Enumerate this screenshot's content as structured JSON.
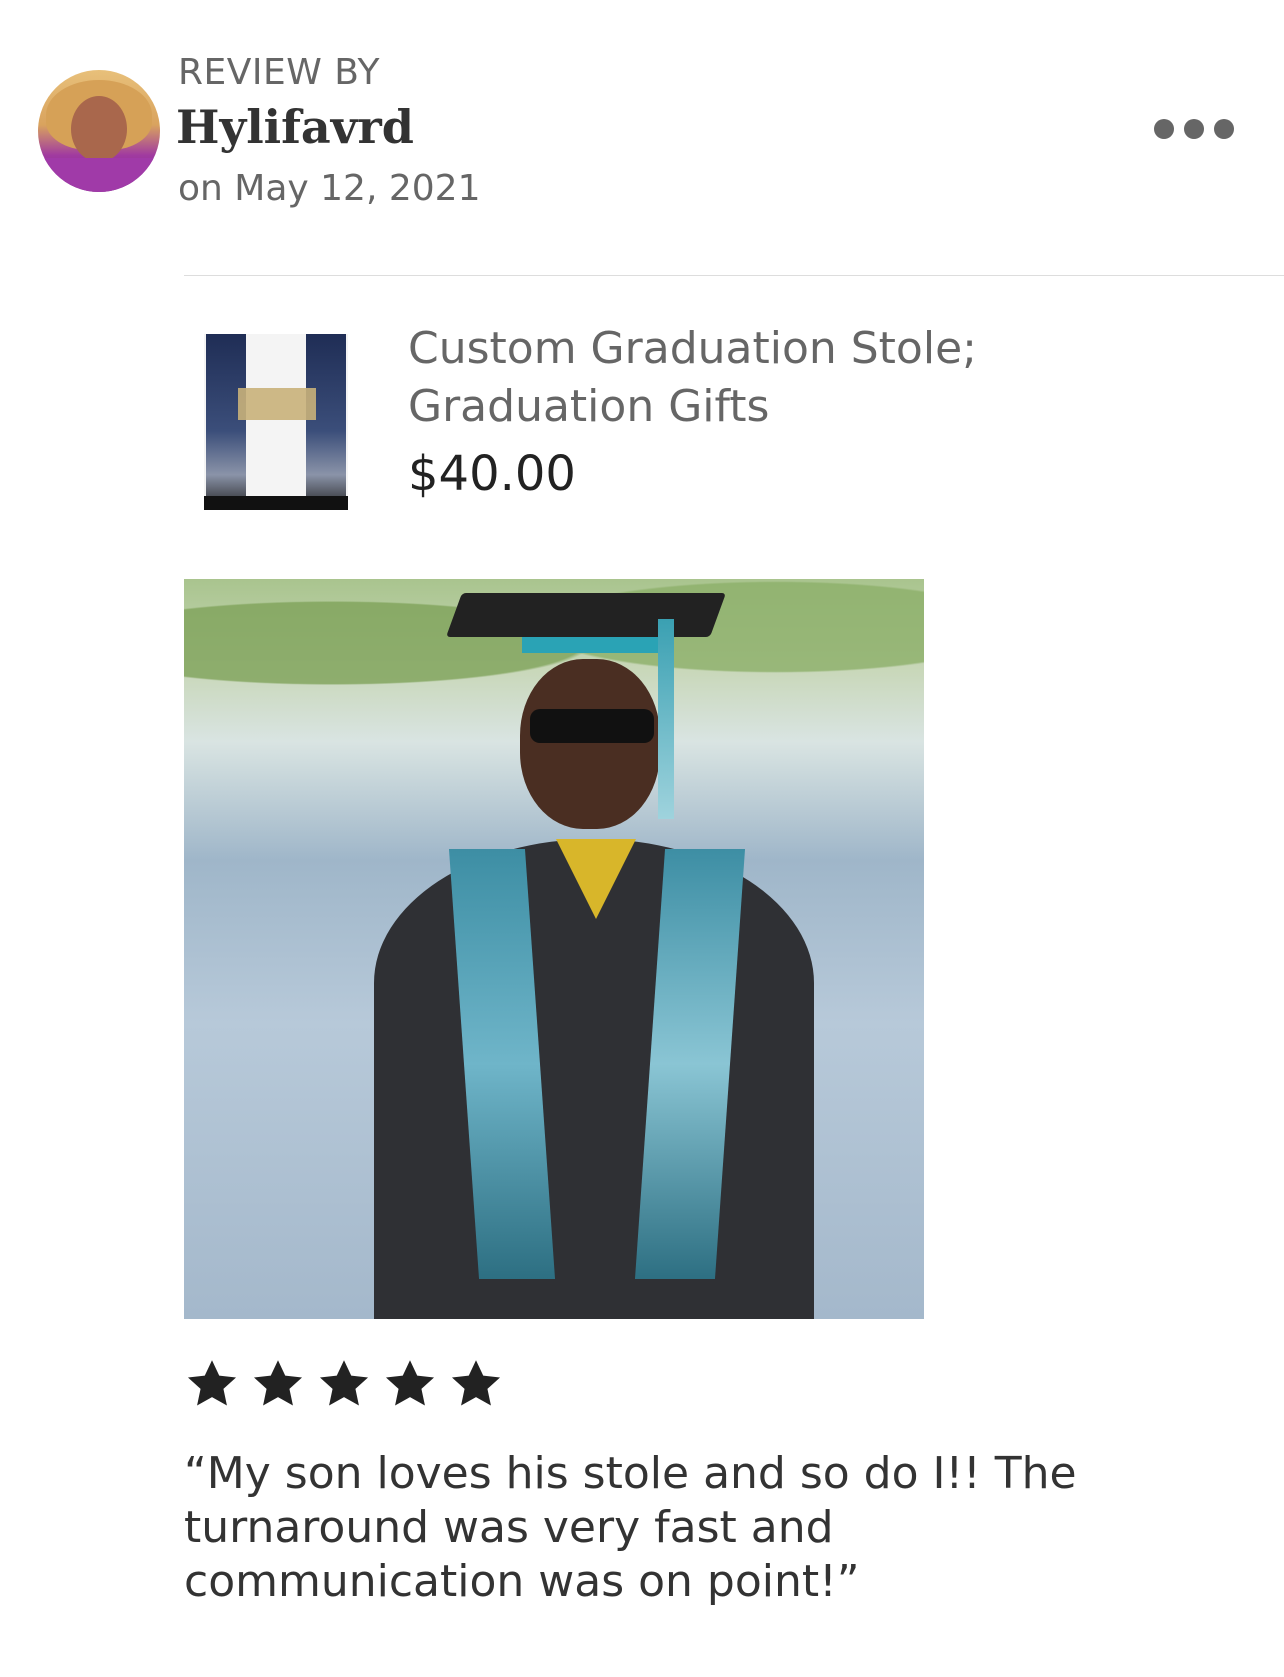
{
  "review": {
    "label": "REVIEW BY",
    "reviewer": "Hylifavrd",
    "date": "on May 12, 2021"
  },
  "product": {
    "title": "Custom Graduation Stole; Graduation Gifts",
    "price": "$40.00"
  },
  "rating": {
    "stars": 5,
    "max": 5
  },
  "review_text": "“My son loves his stole and so do I!! The turnaround was very fast and communication was on point!”",
  "icons": {
    "more": "more-horizontal-icon",
    "star": "star-icon"
  },
  "colors": {
    "text_primary": "#333333",
    "text_secondary": "#666666",
    "divider": "#dddddd"
  }
}
